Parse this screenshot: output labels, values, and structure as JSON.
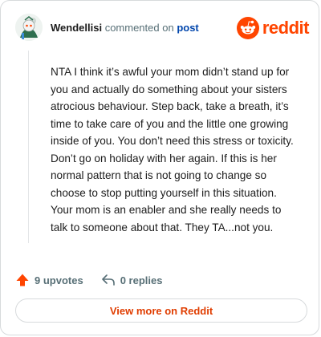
{
  "header": {
    "username": "Wendellisi",
    "action_text": "commented on",
    "post_link": "post",
    "logo_text": "reddit"
  },
  "comment": {
    "body": "NTA I think it’s awful your mom didn’t stand up for you and actually do something about your sisters atrocious behaviour. Step back, take a breath, it’s time to take care of you and the little one growing inside of you. You don’t need this stress or toxicity. Don’t go on holiday with her again. If this is her normal pattern that is not going to change so choose to stop putting yourself in this situation. Your mom is an enabler and she really needs to talk to someone about that. They TA...not you."
  },
  "actions": {
    "upvotes": "9 upvotes",
    "replies": "0 replies"
  },
  "footer": {
    "view_more_label": "View more on Reddit"
  },
  "colors": {
    "accent": "#ff4500",
    "link": "#0045ac",
    "muted": "#576f76"
  }
}
